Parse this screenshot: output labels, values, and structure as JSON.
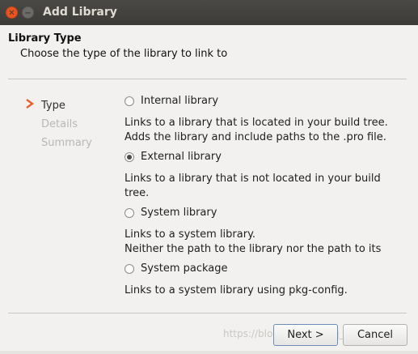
{
  "window": {
    "title": "Add Library"
  },
  "header": {
    "title": "Library Type",
    "subtitle": "Choose the type of the library to link to"
  },
  "steps": [
    {
      "label": "Type",
      "active": true
    },
    {
      "label": "Details",
      "active": false
    },
    {
      "label": "Summary",
      "active": false
    }
  ],
  "options": [
    {
      "label": "Internal library",
      "checked": false,
      "desc_lines": [
        "Links to a library that is located in your build tree.",
        "Adds the library and include paths to the .pro file."
      ]
    },
    {
      "label": "External library",
      "checked": true,
      "desc_lines": [
        "Links to a library that is not located in your build",
        "tree."
      ]
    },
    {
      "label": "System library",
      "checked": false,
      "desc_lines": [
        "Links to a system library.",
        "Neither the path to the library nor the path to its"
      ]
    },
    {
      "label": "System package",
      "checked": false,
      "desc_lines": [
        "Links to a system library using pkg-config."
      ]
    }
  ],
  "buttons": {
    "next": "Next >",
    "cancel": "Cancel"
  },
  "watermark": "https://blog.csdn.net/qq_29017..."
}
